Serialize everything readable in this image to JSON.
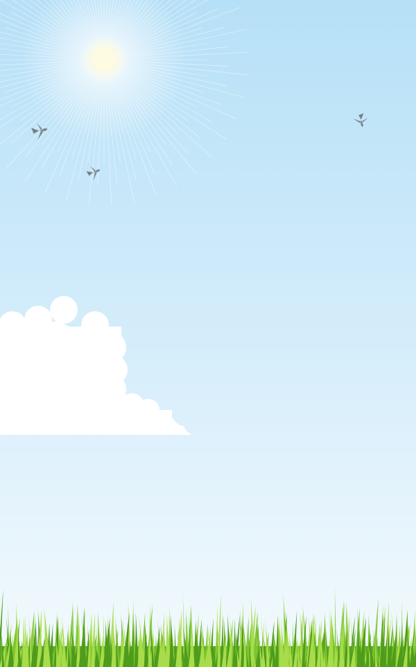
{
  "scene": {
    "subjects": [
      "sky",
      "sun",
      "swallow",
      "swallow",
      "swallow",
      "cloud",
      "grass"
    ]
  },
  "colors": {
    "sky_top": "#b6e0f7",
    "sky_mid": "#d7eefb",
    "sky_bottom": "#f4fafd",
    "sun_core": "#fffbe0",
    "sun_glow": "#ffffff",
    "cloud": "#ffffff",
    "bird": "#7a7f86",
    "grass_light": "#a8dc4a",
    "grass_mid": "#7cc52e",
    "grass_dark": "#4f9c1c"
  }
}
